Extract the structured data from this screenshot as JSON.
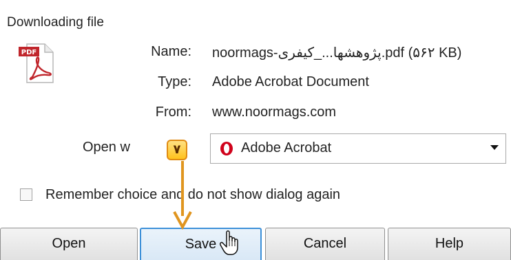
{
  "dialog": {
    "title": "Downloading file"
  },
  "file_icon": {
    "icon": "pdf-file-icon",
    "badge_text": "PDF",
    "color": "#c0262c"
  },
  "details": {
    "name_label": "Name:",
    "name_value": "noormags-پژوهشها..._کیفری.pdf (۵۶۲ KB)",
    "type_label": "Type:",
    "type_value": "Adobe Acrobat Document",
    "from_label": "From:",
    "from_value": "www.noormags.com"
  },
  "open_with": {
    "label": "Open w",
    "selected_value": "Adobe Acrobat",
    "icon": "opera-icon"
  },
  "remember": {
    "label": "Remember choice and do not show dialog again",
    "checked": false
  },
  "buttons": {
    "open": "Open",
    "save": "Save",
    "cancel": "Cancel",
    "help": "Help"
  },
  "tutorial": {
    "step_badge": "۷",
    "accent_color": "#e0951f"
  }
}
